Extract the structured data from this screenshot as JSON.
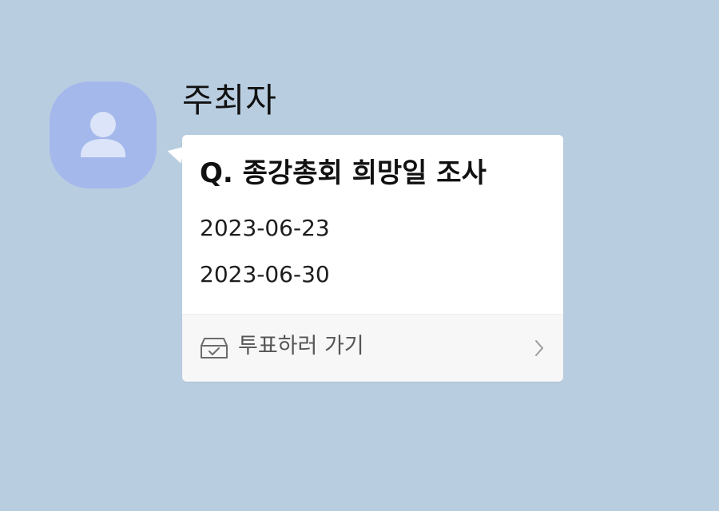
{
  "chat": {
    "sender_name": "주최자"
  },
  "poll": {
    "title": "Q. 종강총회 희망일 조사",
    "options": [
      "2023-06-23",
      "2023-06-30"
    ],
    "action_label": "투표하러 가기"
  },
  "colors": {
    "background": "#b9cde0",
    "avatar_bg": "#a4b8ec",
    "avatar_figure": "#dbe4f8",
    "card_bg": "#ffffff",
    "footer_bg": "#f7f7f7"
  },
  "icons": {
    "avatar": "person-silhouette-icon",
    "action": "ballot-box-icon",
    "chevron": "chevron-right-icon"
  }
}
